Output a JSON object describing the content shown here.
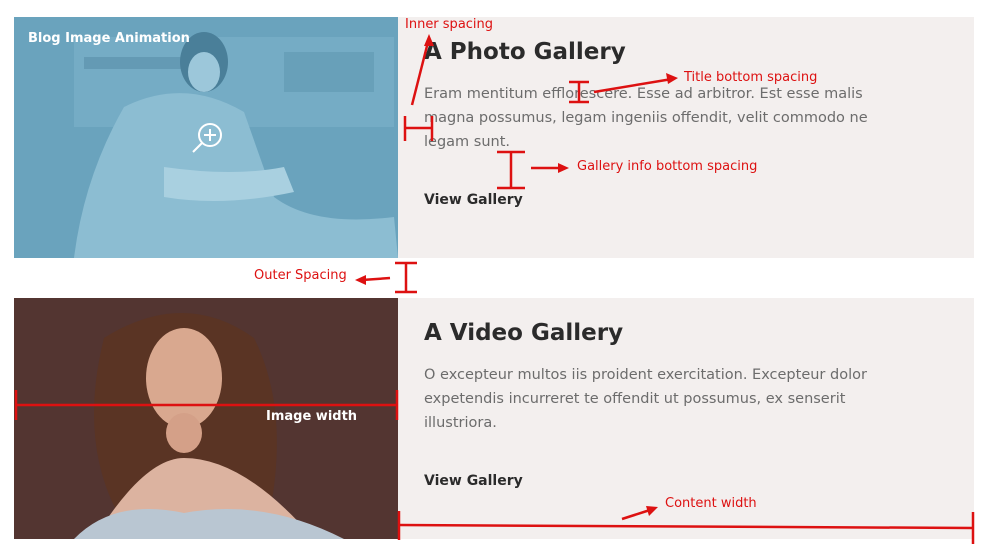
{
  "cards": [
    {
      "thumb_label": "Blog Image Animation",
      "title": "A Photo Gallery",
      "description": "Eram mentitum efflorescere. Esse ad arbitror. Est esse malis magna possumus, legam ingeniis offendit, velit commodo ne legam sunt.",
      "link": "View Gallery",
      "thumb_color": "#6fa8c1"
    },
    {
      "title": "A Video Gallery",
      "description": "O excepteur multos iis proident exercitation. Excepteur dolor expetendis incurreret te offendit ut possumus, ex senserit illustriora.",
      "link": "View Gallery",
      "thumb_color": "#3a2430"
    }
  ],
  "annotations": {
    "inner_spacing": "Inner spacing",
    "title_bottom": "Title bottom spacing",
    "info_bottom": "Gallery info bottom spacing",
    "outer_spacing": "Outer Spacing",
    "image_width": "Image width",
    "content_width": "Content width"
  },
  "colors": {
    "card_background": "#f3efee",
    "annotation": "#dd1111",
    "title_text": "#2b2b2b",
    "body_text": "#6c6c6c"
  }
}
